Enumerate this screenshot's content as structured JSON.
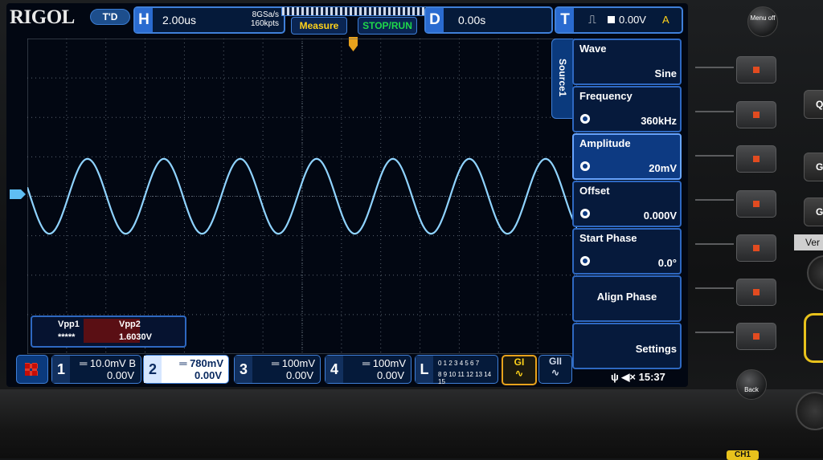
{
  "header": {
    "brand": "RIGOL",
    "mode_badge": "T'D",
    "horizontal": {
      "letter": "H",
      "timebase": "2.00us",
      "sample_rate": "8GSa/s",
      "memory_depth": "160kpts"
    },
    "measure_label": "Measure",
    "stop_run_label": "STOP/RUN",
    "delay": {
      "letter": "D",
      "value": "0.00s"
    },
    "trigger": {
      "letter": "T",
      "level": "0.00V",
      "source": "A"
    }
  },
  "side_menu": {
    "source_tab": "Source1",
    "items": [
      {
        "label": "Wave",
        "value": "Sine"
      },
      {
        "label": "Frequency",
        "value": "360kHz"
      },
      {
        "label": "Amplitude",
        "value": "20mV"
      },
      {
        "label": "Offset",
        "value": "0.000V"
      },
      {
        "label": "Start Phase",
        "value": "0.0°"
      },
      {
        "label": "Align Phase",
        "value": ""
      },
      {
        "label": "Settings",
        "value": ""
      }
    ]
  },
  "measurements": {
    "col1_label": "Vpp1",
    "col1_value": "*****",
    "col2_label": "Vpp2",
    "col2_value": "1.6030V"
  },
  "channels": [
    {
      "num": "1",
      "scale": "10.0mV",
      "bw": "B",
      "offset": "0.00V"
    },
    {
      "num": "2",
      "scale": "780mV",
      "bw": "",
      "offset": "0.00V"
    },
    {
      "num": "3",
      "scale": "100mV",
      "bw": "",
      "offset": "0.00V"
    },
    {
      "num": "4",
      "scale": "100mV",
      "bw": "",
      "offset": "0.00V"
    }
  ],
  "logic": {
    "letter": "L",
    "row1": "0 1 2 3  4 5 6 7",
    "row2": "8 9 10 11  12 13 14 15"
  },
  "generators": {
    "g1": "GI",
    "g2": "GII"
  },
  "status": {
    "clock": "15:37"
  },
  "hardware": {
    "menu_off": "Menu off",
    "back": "Back",
    "ch1": "CH1",
    "vertical": "Ver"
  },
  "waveform": {
    "cycles_on_screen": 7.2,
    "amplitude_div": 0.95,
    "color": "#8fd3ff"
  }
}
